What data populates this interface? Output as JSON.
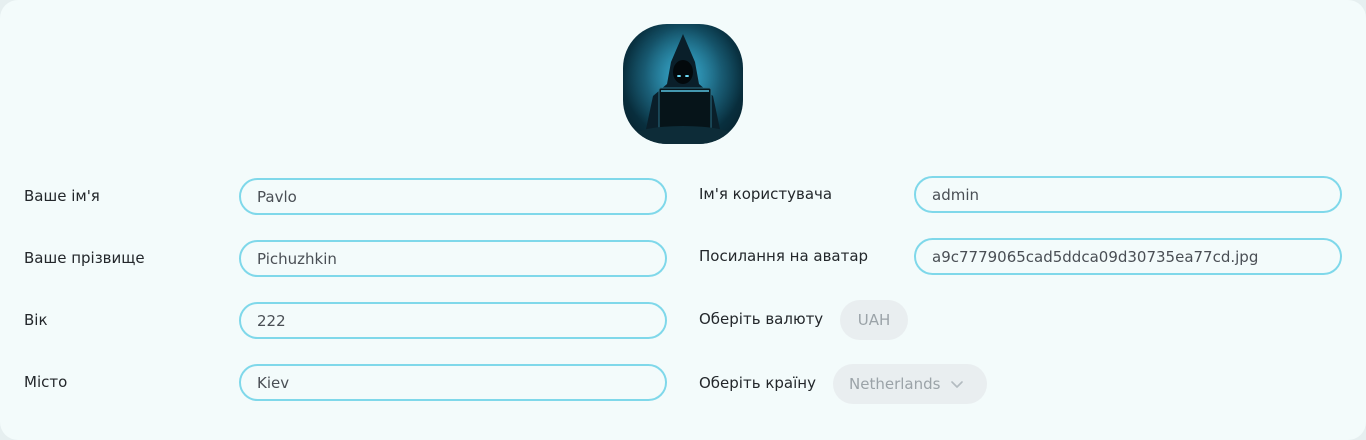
{
  "avatar": {
    "alt_icon": "hooded-hacker-avatar"
  },
  "left": [
    {
      "label": "Ваше ім'я",
      "value": "Pavlo"
    },
    {
      "label": "Ваше прізвище",
      "value": "Pichuzhkin"
    },
    {
      "label": "Вік",
      "value": "222"
    },
    {
      "label": "Місто",
      "value": "Kiev"
    }
  ],
  "right": {
    "username": {
      "label": "Ім'я користувача",
      "value": "admin"
    },
    "avatar_link": {
      "label": "Посилання на аватар",
      "value": "a9c7779065cad5ddca09d30735ea77cd.jpg"
    },
    "currency": {
      "label": "Оберіть валюту",
      "selected": "UAH"
    },
    "country": {
      "label": "Оберіть країну",
      "selected": "Netherlands"
    }
  },
  "colors": {
    "accent_border": "#7fd8ea",
    "card_bg": "#f3fbfb",
    "pill_bg": "#e9eef0"
  }
}
